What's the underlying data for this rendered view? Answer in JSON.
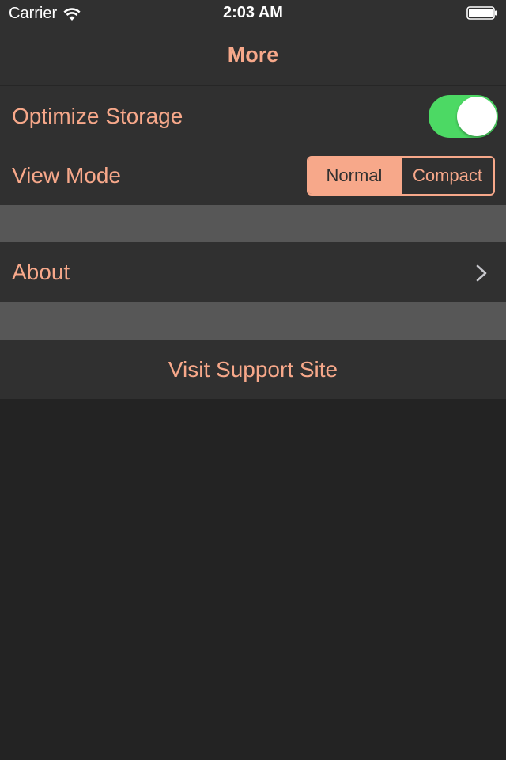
{
  "status_bar": {
    "carrier": "Carrier",
    "time": "2:03 AM"
  },
  "nav": {
    "title": "More"
  },
  "settings": {
    "optimize_storage": {
      "label": "Optimize Storage",
      "enabled": true
    },
    "view_mode": {
      "label": "View Mode",
      "options": [
        "Normal",
        "Compact"
      ],
      "selected": "Normal"
    },
    "about": {
      "label": "About"
    },
    "support": {
      "label": "Visit Support Site"
    }
  },
  "colors": {
    "accent": "#f7a88a",
    "toggle_on": "#4cd964",
    "row_bg": "#303030",
    "section_gap": "#575757",
    "background": "#232323"
  }
}
